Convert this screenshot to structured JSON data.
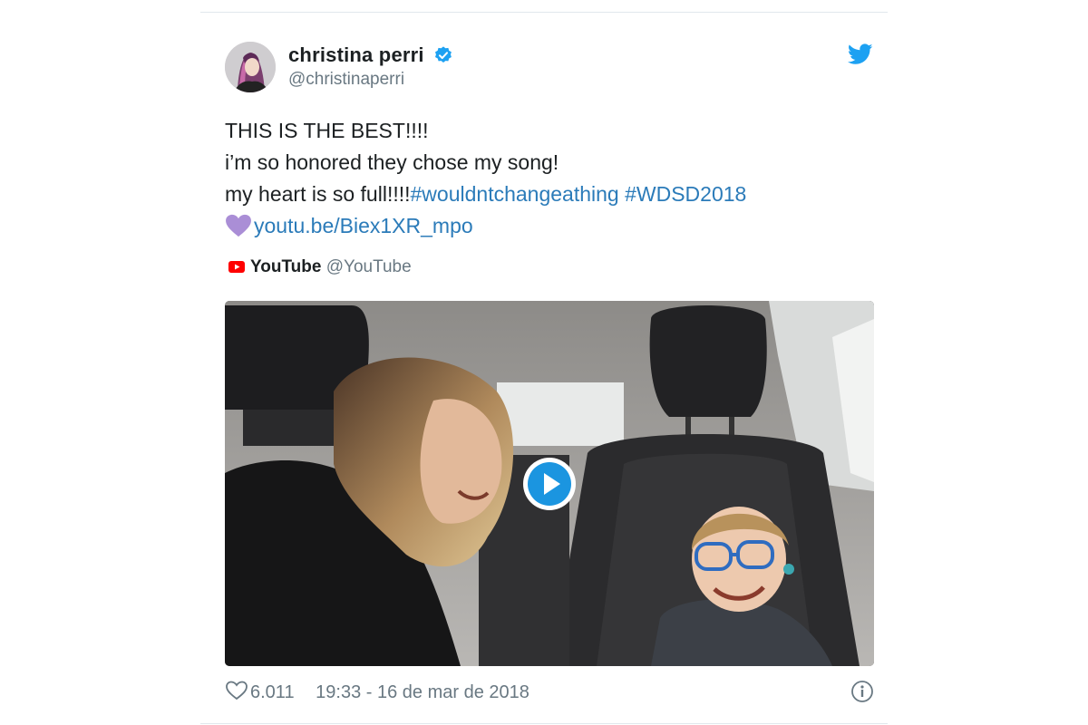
{
  "tweet": {
    "author": {
      "name": "christina perri",
      "handle": "@christinaperri",
      "verified": true,
      "avatar_icon": "avatar-photo"
    },
    "lines": [
      {
        "text": "THIS IS THE BEST!!!!"
      },
      {
        "text": "i’m so honored they chose my song!"
      },
      {
        "text": "my heart is so full!!!!",
        "hashtags": "#wouldntchangeathing #WDSD2018"
      },
      {
        "emoji": "purple-heart-icon",
        "link": "youtu.be/Biex1XR_mpo"
      }
    ],
    "card_source": {
      "icon": "youtube-icon",
      "name": "YouTube",
      "handle": "@YouTube"
    },
    "media": {
      "type": "video-thumbnail",
      "play_icon": "play-icon"
    },
    "footer": {
      "likes": "6.011",
      "timestamp": "19:33 - 16 de mar de 2018",
      "info_icon": "info-icon"
    },
    "colors": {
      "link": "#2b7bb9",
      "verified": "#1da1f2",
      "twitter_bird": "#1da1f2",
      "youtube_red": "#ff0000",
      "heart_emoji": "#aa8ed6",
      "secondary_text": "#697882"
    }
  }
}
